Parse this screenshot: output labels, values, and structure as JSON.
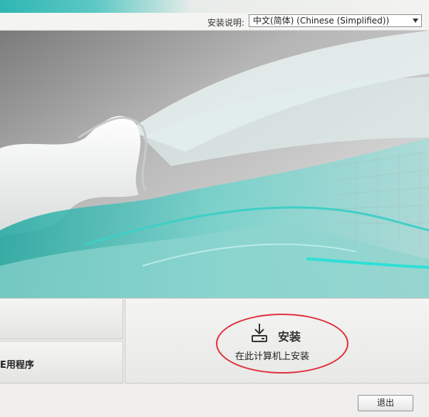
{
  "toolbar": {
    "lang_label": "安装说明:",
    "lang_selected": "中文(简体) (Chinese (Simplified))"
  },
  "tiles": {
    "bottom_label": "E用程序"
  },
  "install": {
    "title": "安装",
    "subtitle": "在此计算机上安装"
  },
  "footer": {
    "exit_label": "退出"
  },
  "colors": {
    "accent_teal": "#2fb6b3",
    "annotation_red": "#e0303a"
  },
  "icons": {
    "install": "download-arrow-icon",
    "dropdown": "chevron-down-icon"
  }
}
